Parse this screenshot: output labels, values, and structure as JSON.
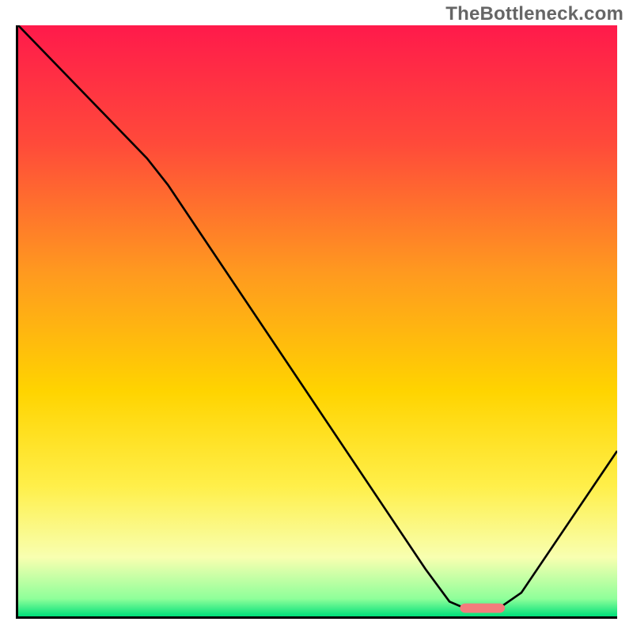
{
  "watermark": "TheBottleneck.com",
  "chart_data": {
    "type": "line",
    "title": "",
    "xlabel": "",
    "ylabel": "",
    "xlim": [
      0,
      100
    ],
    "ylim": [
      0,
      100
    ],
    "gradient_stops": [
      {
        "offset": 0.0,
        "color": "#ff1a4b"
      },
      {
        "offset": 0.2,
        "color": "#ff4a3a"
      },
      {
        "offset": 0.42,
        "color": "#ff9a1f"
      },
      {
        "offset": 0.62,
        "color": "#ffd400"
      },
      {
        "offset": 0.78,
        "color": "#ffef4a"
      },
      {
        "offset": 0.9,
        "color": "#f8ffb0"
      },
      {
        "offset": 0.97,
        "color": "#8fff9a"
      },
      {
        "offset": 1.0,
        "color": "#00e07a"
      }
    ],
    "curve": [
      {
        "x": 0.0,
        "y": 100.0
      },
      {
        "x": 21.5,
        "y": 77.5
      },
      {
        "x": 25.0,
        "y": 73.0
      },
      {
        "x": 68.0,
        "y": 8.0
      },
      {
        "x": 72.0,
        "y": 2.5
      },
      {
        "x": 75.0,
        "y": 1.2
      },
      {
        "x": 80.0,
        "y": 1.2
      },
      {
        "x": 84.0,
        "y": 4.0
      },
      {
        "x": 100.0,
        "y": 28.0
      }
    ],
    "marker": {
      "x": 77.5,
      "y": 1.4,
      "w": 7.5,
      "h": 1.6,
      "color": "#f47c7c"
    }
  }
}
